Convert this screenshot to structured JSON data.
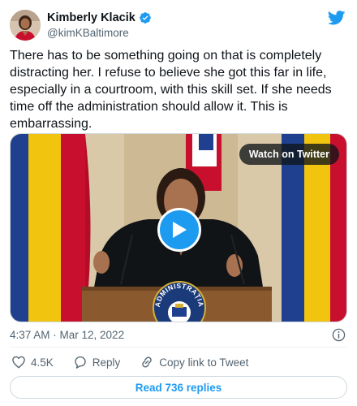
{
  "author": {
    "display_name": "Kimberly Klacik",
    "handle": "@kimKBaltimore",
    "verified": true
  },
  "tweet": {
    "text": "There has to be something going on that is completely distracting her. I refuse to believe she got this far in life, especially in a courtroom, with this skill set. If she needs time off the administration should allow it. This is embarrassing.",
    "timestamp": "4:37 AM · Mar 12, 2022"
  },
  "media": {
    "watch_label": "Watch on Twitter",
    "podium_text": "ADMINISTRAȚIA"
  },
  "actions": {
    "like_count": "4.5K",
    "reply_label": "Reply",
    "copy_label": "Copy link to Tweet"
  },
  "replies_button": "Read 736 replies",
  "colors": {
    "accent": "#1d9bf0",
    "text": "#0f1419",
    "muted": "#536471",
    "border": "#cfd9de"
  },
  "icons": [
    "verified-badge-icon",
    "twitter-bird-icon",
    "play-icon",
    "info-icon",
    "heart-icon",
    "reply-icon",
    "copy-link-icon"
  ]
}
